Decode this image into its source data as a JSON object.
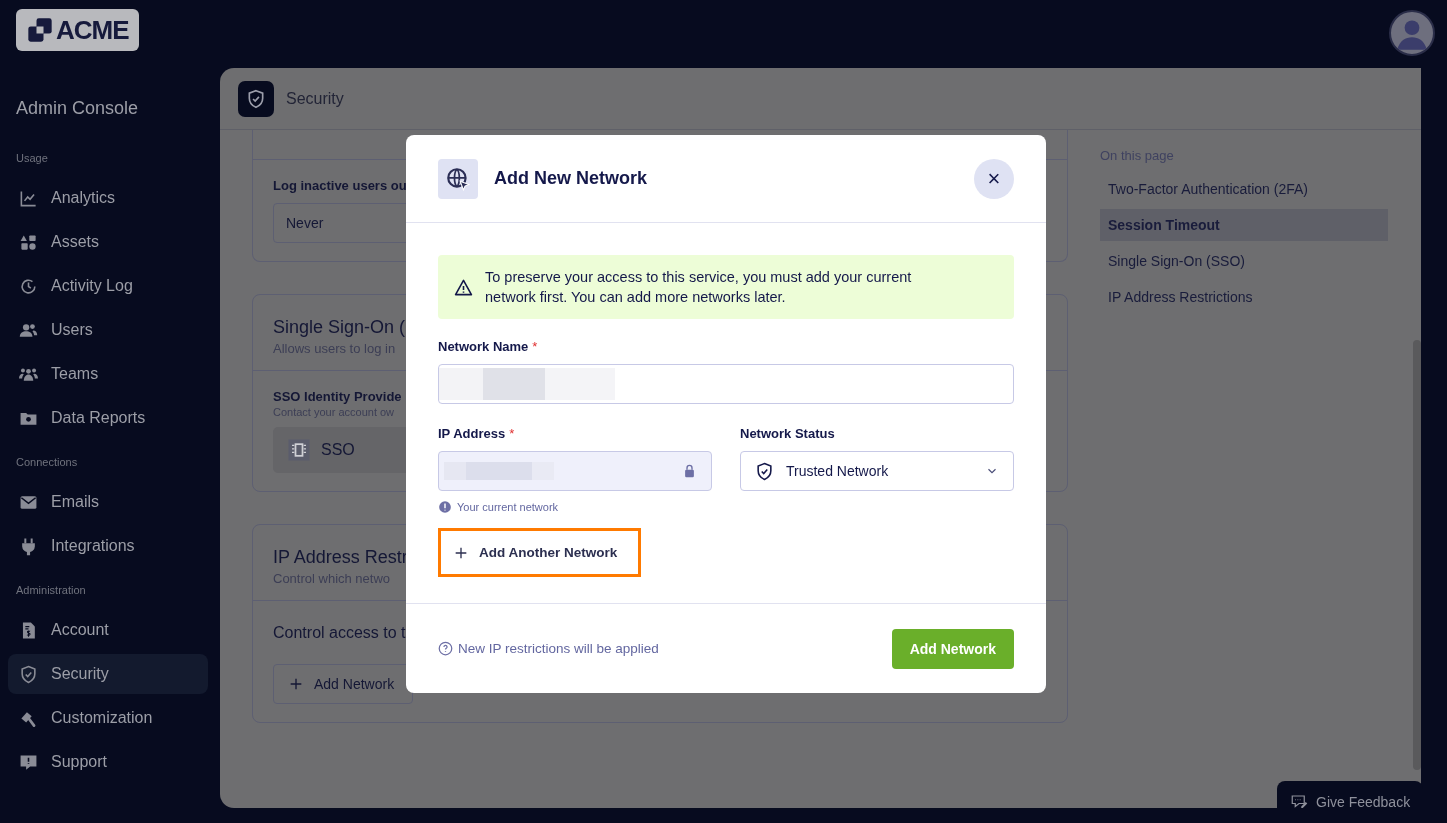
{
  "header": {
    "logo": "ACME"
  },
  "sidebar": {
    "title": "Admin Console",
    "sections": [
      {
        "label": "Usage",
        "items": [
          {
            "label": "Analytics",
            "selected": false
          },
          {
            "label": "Assets",
            "selected": false
          },
          {
            "label": "Activity Log",
            "selected": false
          },
          {
            "label": "Users",
            "selected": false
          },
          {
            "label": "Teams",
            "selected": false
          },
          {
            "label": "Data Reports",
            "selected": false
          }
        ]
      },
      {
        "label": "Connections",
        "items": [
          {
            "label": "Emails",
            "selected": false
          },
          {
            "label": "Integrations",
            "selected": false
          }
        ]
      },
      {
        "label": "Administration",
        "items": [
          {
            "label": "Account",
            "selected": false
          },
          {
            "label": "Security",
            "selected": true
          },
          {
            "label": "Customization",
            "selected": false
          },
          {
            "label": "Support",
            "selected": false
          }
        ]
      }
    ]
  },
  "panel": {
    "title": "Security"
  },
  "cards": [
    {
      "kind": "select",
      "label": "Log inactive users ou",
      "value": "Never"
    },
    {
      "kind": "sso",
      "title": "Single Sign-On (",
      "subtitle": "Allows users to log in",
      "label": "SSO Identity Provide",
      "hint": "Contact your account ow",
      "option": "SSO"
    },
    {
      "kind": "ip",
      "title": "IP Address Restr",
      "subtitle": "Control which netwo",
      "text": "Control access to t",
      "button": "Add Network"
    }
  ],
  "toc": {
    "heading": "On this page",
    "items": [
      {
        "label": "Two-Factor Authentication (2FA)",
        "selected": false
      },
      {
        "label": "Session Timeout",
        "selected": true
      },
      {
        "label": "Single Sign-On (SSO)",
        "selected": false
      },
      {
        "label": "IP Address Restrictions",
        "selected": false
      }
    ]
  },
  "feedback": "Give Feedback",
  "modal": {
    "title": "Add New Network",
    "close": "×",
    "alert": "To preserve your access to this service, you must add your current network first. You can add more networks later.",
    "name_label": "Network Name",
    "ip_label": "IP Address",
    "required": "*",
    "status_label": "Network Status",
    "status_value": "Trusted Network",
    "ip_hint": "Your current network",
    "add_another": {
      "label": "Add Another Network",
      "highlighted": true
    },
    "footer_note": "New IP restrictions will be applied",
    "submit": "Add Network"
  }
}
